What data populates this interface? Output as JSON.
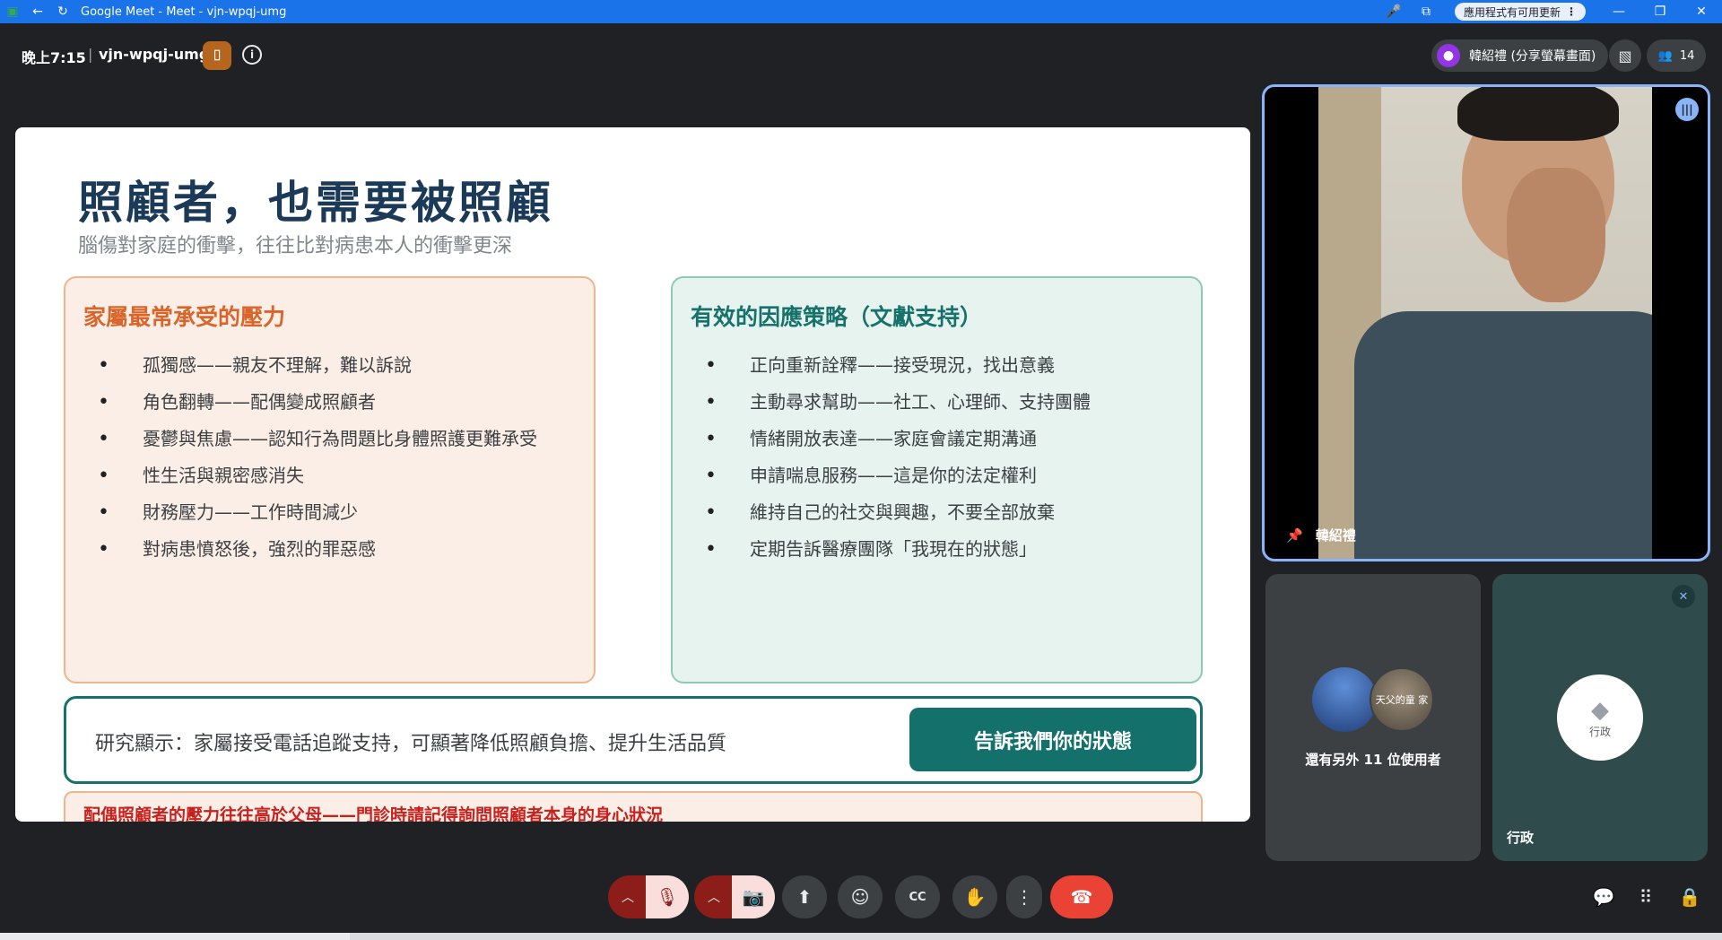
{
  "window": {
    "title": "Google Meet - Meet - vjn-wpqj-umg",
    "update_label": "應用程式有可用更新"
  },
  "meeting": {
    "time": "晚上7:15",
    "code": "vjn-wpqj-umg",
    "presenter": "韓紹禮 (分享螢幕畫面)",
    "participant_count": "14"
  },
  "slide": {
    "title": "照顧者，也需要被照顧",
    "subtitle": "腦傷對家庭的衝擊，往往比對病患本人的衝擊更深",
    "left_card": {
      "title": "家屬最常承受的壓力",
      "items": [
        "孤獨感——親友不理解，難以訴說",
        "角色翻轉——配偶變成照顧者",
        "憂鬱與焦慮——認知行為問題比身體照護更難承受",
        "性生活與親密感消失",
        "財務壓力——工作時間減少",
        "對病患憤怒後，強烈的罪惡感"
      ]
    },
    "right_card": {
      "title": "有效的因應策略（文獻支持）",
      "items": [
        "正向重新詮釋——接受現況，找出意義",
        "主動尋求幫助——社工、心理師、支持團體",
        "情緒開放表達——家庭會議定期溝通",
        "申請喘息服務——這是你的法定權利",
        "維持自己的社交與興趣，不要全部放棄",
        "定期告訴醫療團隊「我現在的狀態」"
      ]
    },
    "research_text": "研究顯示：家屬接受電話追蹤支持，可顯著降低照顧負擔、提升生活品質",
    "cta_label": "告訴我們你的狀態",
    "warning_text": "配偶照顧者的壓力往往高於父母——門診時請記得詢問照顧者本身的身心狀況"
  },
  "tiles": {
    "main_name": "韓紹禮",
    "others_label": "還有另外 11 位使用者",
    "others_avatar_text": "天父的童 家",
    "admin_name": "行政",
    "admin_avatar_text": "行政"
  },
  "icons": {
    "pin": "📌",
    "mic_off": "🎙",
    "cam_off": "📷",
    "present": "⬆",
    "emoji": "☺",
    "captions": "CC",
    "hand": "✋",
    "more": "⋮",
    "hangup": "☎",
    "chat": "💬",
    "apps": "⠿",
    "host": "🔒"
  }
}
